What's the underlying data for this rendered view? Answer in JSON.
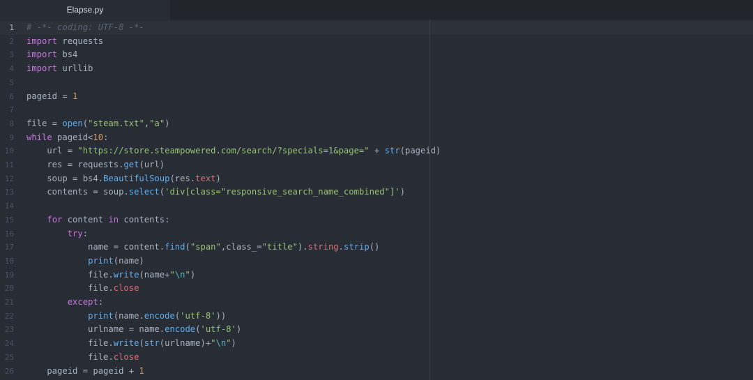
{
  "tab": {
    "title": "Elapse.py"
  },
  "colors": {
    "background": "#282c34",
    "keyword": "#c678dd",
    "string": "#98c379",
    "number": "#d19a66",
    "function": "#61afef",
    "comment": "#5c6370",
    "property": "#e06c75",
    "escape": "#56b6c2",
    "text": "#abb2bf"
  },
  "editor": {
    "line_numbers": [
      "1",
      "2",
      "3",
      "4",
      "5",
      "6",
      "7",
      "8",
      "9",
      "10",
      "11",
      "12",
      "13",
      "14",
      "15",
      "16",
      "17",
      "18",
      "19",
      "20",
      "21",
      "22",
      "23",
      "24",
      "25",
      "26"
    ],
    "lines": [
      [
        [
          "c",
          "# -*- coding: UTF-8 -*-"
        ]
      ],
      [
        [
          "k",
          "import"
        ],
        [
          "t",
          " requests"
        ]
      ],
      [
        [
          "k",
          "import"
        ],
        [
          "t",
          " bs4"
        ]
      ],
      [
        [
          "k",
          "import"
        ],
        [
          "t",
          " urllib"
        ]
      ],
      [],
      [
        [
          "t",
          "pageid = "
        ],
        [
          "n",
          "1"
        ]
      ],
      [],
      [
        [
          "t",
          "file = "
        ],
        [
          "f",
          "open"
        ],
        [
          "t",
          "("
        ],
        [
          "s",
          "\"steam.txt\""
        ],
        [
          "t",
          ","
        ],
        [
          "s",
          "\"a\""
        ],
        [
          "t",
          ")"
        ]
      ],
      [
        [
          "k",
          "while"
        ],
        [
          "t",
          " pageid<"
        ],
        [
          "n",
          "10"
        ],
        [
          "t",
          ":"
        ]
      ],
      [
        [
          "t",
          "    url = "
        ],
        [
          "s",
          "\"https://store.steampowered.com/search/?specials=1&page=\""
        ],
        [
          "t",
          " + "
        ],
        [
          "f",
          "str"
        ],
        [
          "t",
          "(pageid)"
        ]
      ],
      [
        [
          "t",
          "    res = requests."
        ],
        [
          "f",
          "get"
        ],
        [
          "t",
          "(url)"
        ]
      ],
      [
        [
          "t",
          "    soup = bs4."
        ],
        [
          "f",
          "BeautifulSoup"
        ],
        [
          "t",
          "(res."
        ],
        [
          "p",
          "text"
        ],
        [
          "t",
          ")"
        ]
      ],
      [
        [
          "t",
          "    contents = soup."
        ],
        [
          "f",
          "select"
        ],
        [
          "t",
          "("
        ],
        [
          "s",
          "'div[class=\"responsive_search_name_combined\"]'"
        ],
        [
          "t",
          ")"
        ]
      ],
      [],
      [
        [
          "t",
          "    "
        ],
        [
          "k",
          "for"
        ],
        [
          "t",
          " content "
        ],
        [
          "k",
          "in"
        ],
        [
          "t",
          " contents:"
        ]
      ],
      [
        [
          "t",
          "        "
        ],
        [
          "k",
          "try"
        ],
        [
          "t",
          ":"
        ]
      ],
      [
        [
          "t",
          "            name = content."
        ],
        [
          "f",
          "find"
        ],
        [
          "t",
          "("
        ],
        [
          "s",
          "\"span\""
        ],
        [
          "t",
          ",class_="
        ],
        [
          "s",
          "\"title\""
        ],
        [
          "t",
          ")."
        ],
        [
          "p",
          "string"
        ],
        [
          "t",
          "."
        ],
        [
          "f",
          "strip"
        ],
        [
          "t",
          "()"
        ]
      ],
      [
        [
          "t",
          "            "
        ],
        [
          "f",
          "print"
        ],
        [
          "t",
          "(name)"
        ]
      ],
      [
        [
          "t",
          "            file."
        ],
        [
          "f",
          "write"
        ],
        [
          "t",
          "(name+"
        ],
        [
          "s",
          "\""
        ],
        [
          "e",
          "\\n"
        ],
        [
          "s",
          "\""
        ],
        [
          "t",
          ")"
        ]
      ],
      [
        [
          "t",
          "            file."
        ],
        [
          "p",
          "close"
        ]
      ],
      [
        [
          "t",
          "        "
        ],
        [
          "k",
          "except"
        ],
        [
          "t",
          ":"
        ]
      ],
      [
        [
          "t",
          "            "
        ],
        [
          "f",
          "print"
        ],
        [
          "t",
          "(name."
        ],
        [
          "f",
          "encode"
        ],
        [
          "t",
          "("
        ],
        [
          "s",
          "'utf-8'"
        ],
        [
          "t",
          "))"
        ]
      ],
      [
        [
          "t",
          "            urlname = name."
        ],
        [
          "f",
          "encode"
        ],
        [
          "t",
          "("
        ],
        [
          "s",
          "'utf-8'"
        ],
        [
          "t",
          ")"
        ]
      ],
      [
        [
          "t",
          "            file."
        ],
        [
          "f",
          "write"
        ],
        [
          "t",
          "("
        ],
        [
          "f",
          "str"
        ],
        [
          "t",
          "(urlname)+"
        ],
        [
          "s",
          "\""
        ],
        [
          "e",
          "\\n"
        ],
        [
          "s",
          "\""
        ],
        [
          "t",
          ")"
        ]
      ],
      [
        [
          "t",
          "            file."
        ],
        [
          "p",
          "close"
        ]
      ],
      [
        [
          "t",
          "    pageid = pageid + "
        ],
        [
          "n",
          "1"
        ]
      ]
    ]
  }
}
